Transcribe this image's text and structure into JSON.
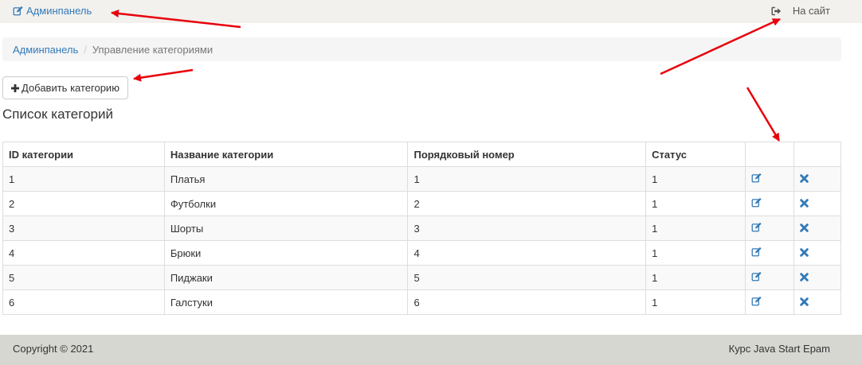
{
  "header": {
    "brand_label": "Админпанель",
    "to_site_label": "На сайт"
  },
  "breadcrumb": {
    "home": "Админпанель",
    "separator": "/",
    "current": "Управление категориями"
  },
  "actions": {
    "add_label": "Добавить категорию"
  },
  "list": {
    "title": "Список категорий",
    "columns": [
      "ID категории",
      "Название категории",
      "Порядковый номер",
      "Статус",
      "",
      ""
    ],
    "rows": [
      {
        "id": "1",
        "name": "Платья",
        "order": "1",
        "status": "1"
      },
      {
        "id": "2",
        "name": "Футболки",
        "order": "2",
        "status": "1"
      },
      {
        "id": "3",
        "name": "Шорты",
        "order": "3",
        "status": "1"
      },
      {
        "id": "4",
        "name": "Брюки",
        "order": "4",
        "status": "1"
      },
      {
        "id": "5",
        "name": "Пиджаки",
        "order": "5",
        "status": "1"
      },
      {
        "id": "6",
        "name": "Галстуки",
        "order": "6",
        "status": "1"
      }
    ]
  },
  "footer": {
    "copyright": "Copyright © 2021",
    "course": "Курс Java Start Epam"
  },
  "icons": {
    "brand": "edit-icon",
    "to_site": "sign-out-icon",
    "add": "plus-icon",
    "row_edit": "edit-icon",
    "row_delete": "remove-icon"
  },
  "colors": {
    "link": "#337ab7",
    "topbar_bg": "#f2f1ee",
    "footer_bg": "#d7d7d1",
    "breadcrumb_bg": "#f5f5f5",
    "stripe_bg": "#f9f9f9",
    "annotation_arrow": "#e8000b"
  }
}
